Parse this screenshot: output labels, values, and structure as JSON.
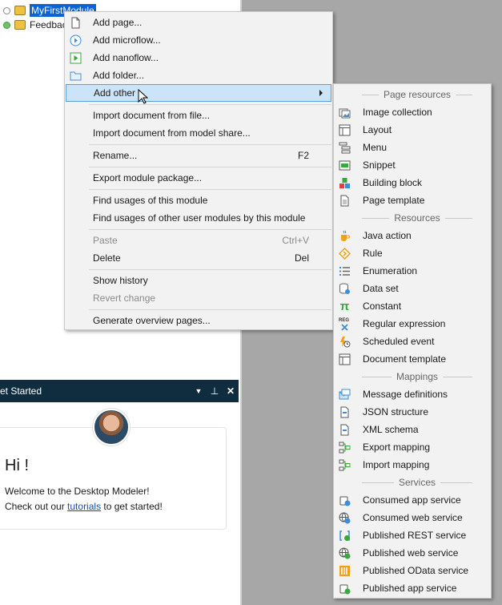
{
  "tree": {
    "items": [
      {
        "label": "MyFirstModule",
        "selected": true
      },
      {
        "label": "Feedbac",
        "selected": false
      }
    ]
  },
  "get_started": {
    "title": "et Started",
    "greeting": "Hi !",
    "welcome": "Welcome to the Desktop Modeler!",
    "check_prefix": "Check out our ",
    "link": "tutorials",
    "check_suffix": " to get started!",
    "controls": {
      "dropdown": "▼",
      "pin": "⊥",
      "close": "✕"
    }
  },
  "context_menu": {
    "items": [
      {
        "label": "Add page...",
        "icon": "page-icon"
      },
      {
        "label": "Add microflow...",
        "icon": "microflow-icon"
      },
      {
        "label": "Add nanoflow...",
        "icon": "nanoflow-icon"
      },
      {
        "label": "Add folder...",
        "icon": "folder-icon"
      },
      {
        "label": "Add other",
        "highlighted": true
      },
      {
        "label": "Import document from file..."
      },
      {
        "label": "Import document from model share..."
      },
      {
        "label": "Rename...",
        "shortcut": "F2"
      },
      {
        "label": "Export module package..."
      },
      {
        "label": "Find usages of this module"
      },
      {
        "label": "Find usages of other user modules by this module"
      },
      {
        "label": "Paste",
        "shortcut": "Ctrl+V",
        "disabled": true
      },
      {
        "label": "Delete",
        "shortcut": "Del"
      },
      {
        "label": "Show history"
      },
      {
        "label": "Revert change",
        "disabled": true
      },
      {
        "label": "Generate overview pages..."
      }
    ]
  },
  "submenu": {
    "sections": {
      "page_resources": "Page resources",
      "resources": "Resources",
      "mappings": "Mappings",
      "services": "Services"
    },
    "items": [
      {
        "label": "Image collection",
        "icon": "image-collection-icon"
      },
      {
        "label": "Layout",
        "icon": "layout-icon"
      },
      {
        "label": "Menu",
        "icon": "menu-icon"
      },
      {
        "label": "Snippet",
        "icon": "snippet-icon"
      },
      {
        "label": "Building block",
        "icon": "building-block-icon"
      },
      {
        "label": "Page template",
        "icon": "page-template-icon"
      },
      {
        "label": "Java action",
        "icon": "java-action-icon"
      },
      {
        "label": "Rule",
        "icon": "rule-icon"
      },
      {
        "label": "Enumeration",
        "icon": "enumeration-icon"
      },
      {
        "label": "Data set",
        "icon": "data-set-icon"
      },
      {
        "label": "Constant",
        "icon": "constant-icon",
        "glyph": "π"
      },
      {
        "label": "Regular expression",
        "icon": "regex-icon",
        "glyph": "REG"
      },
      {
        "label": "Scheduled event",
        "icon": "scheduled-event-icon"
      },
      {
        "label": "Document template",
        "icon": "document-template-icon"
      },
      {
        "label": "Message definitions",
        "icon": "message-definitions-icon"
      },
      {
        "label": "JSON structure",
        "icon": "json-structure-icon"
      },
      {
        "label": "XML schema",
        "icon": "xml-schema-icon"
      },
      {
        "label": "Export mapping",
        "icon": "export-mapping-icon"
      },
      {
        "label": "Import mapping",
        "icon": "import-mapping-icon"
      },
      {
        "label": "Consumed app service",
        "icon": "consumed-app-service-icon"
      },
      {
        "label": "Consumed web service",
        "icon": "consumed-web-service-icon"
      },
      {
        "label": "Published REST service",
        "icon": "published-rest-service-icon"
      },
      {
        "label": "Published web service",
        "icon": "published-web-service-icon"
      },
      {
        "label": "Published OData service",
        "icon": "published-odata-service-icon"
      },
      {
        "label": "Published app service",
        "icon": "published-app-service-icon"
      }
    ]
  },
  "colors": {
    "selection": "#0a64d7",
    "highlight_bg": "#cce4f7",
    "highlight_border": "#5a9fd4",
    "menu_bg": "#f2f2f2",
    "header_bg": "#0f2d3f",
    "accent_green": "#3aa83a",
    "accent_blue": "#3c8ddc"
  }
}
